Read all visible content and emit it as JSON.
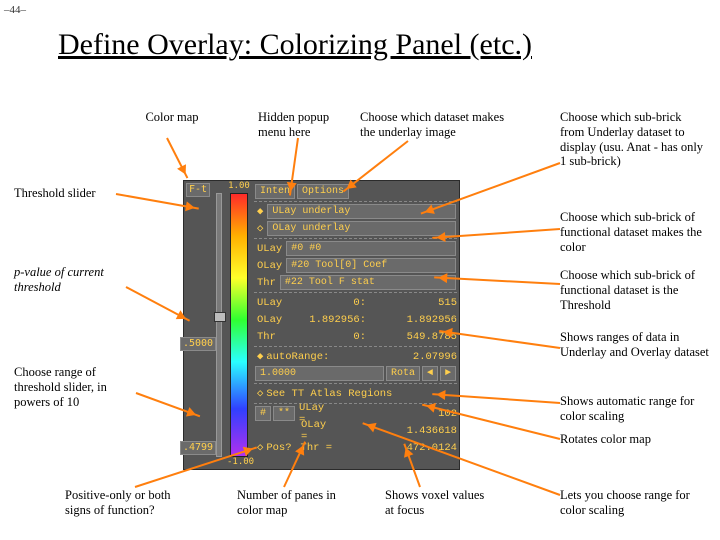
{
  "page_number": "–44–",
  "title": "Define Overlay: Colorizing Panel (etc.)",
  "annotations": {
    "color_map": "Color map",
    "hidden_popup": "Hidden popup menu here",
    "choose_dataset": "Choose which dataset makes the underlay image",
    "choose_sub_underlay": "Choose which sub-brick from Underlay dataset to display (usu. Anat - has only 1 sub-brick)",
    "threshold_slider": "Threshold slider",
    "choose_sub_color": "Choose which sub-brick of functional dataset makes the color",
    "pvalue": "p-value of current threshold",
    "choose_sub_thresh": "Choose which sub-brick of functional dataset is the Threshold",
    "shows_ranges": "Shows ranges of data in Underlay and Overlay dataset",
    "choose_range": "Choose range of threshold slider, in powers of 10",
    "shows_auto": "Shows automatic range for color scaling",
    "rotates": "Rotates color map",
    "pos_only": "Positive-only or both signs of function?",
    "num_panes": "Number of panes in color map",
    "voxel_focus": "Shows voxel values at focus",
    "lets_range": "Lets you choose range for color scaling"
  },
  "panel": {
    "left": {
      "ft": "F-t",
      "pval": ".5000",
      "bottom": ".4799"
    },
    "cbar": {
      "top": "1.00",
      "bottom": "-1.00"
    },
    "header": {
      "inten": "Inten",
      "options": "Options"
    },
    "ulay_btn": "ULay underlay",
    "olay_btn": "OLay underlay",
    "ulay_sel": {
      "lbl": "ULay",
      "val": "#0 #0"
    },
    "olay_sel": {
      "lbl": "OLay",
      "val": "#20 Tool[0] Coef"
    },
    "thr_sel": {
      "lbl": "Thr",
      "val": "#22 Tool F stat"
    },
    "ranges": {
      "ulay": {
        "lbl": "ULay",
        "a": "0:",
        "b": "515"
      },
      "olay": {
        "lbl": "OLay",
        "a": "1.892956:",
        "b": "1.892956"
      },
      "thr": {
        "lbl": "Thr",
        "a": "0:",
        "b": "549.8785"
      }
    },
    "auto": {
      "chk": "autoRange:",
      "val": "2.07996"
    },
    "range_row": {
      "val": "1.0000",
      "rota": "Rota"
    },
    "see_atlas": "See TT Atlas Regions",
    "panes": {
      "num": "#",
      "stars": "**"
    },
    "footer": {
      "ulay": {
        "lbl": "ULay =",
        "val": "102"
      },
      "olay": {
        "lbl": "OLay =",
        "val": "1.436618"
      },
      "pos": {
        "lbl": "Pos?",
        "thr_lbl": "Thr  =",
        "thr_val": "472.0124"
      }
    }
  }
}
